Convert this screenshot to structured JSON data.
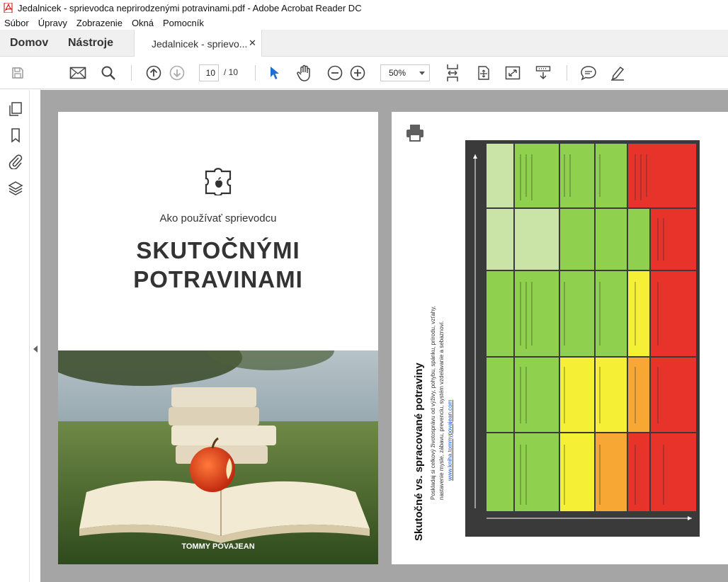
{
  "window": {
    "title": "Jedalnicek - sprievodca neprirodzenými potravinami.pdf - Adobe Acrobat Reader DC"
  },
  "menu": {
    "items": [
      "Súbor",
      "Úpravy",
      "Zobrazenie",
      "Okná",
      "Pomocník"
    ]
  },
  "tabs": {
    "home": "Domov",
    "tools": "Nástroje",
    "document": "Jedalnicek - sprievo...",
    "close_glyph": "✕"
  },
  "toolbar": {
    "current_page": "10",
    "total_pages": "/ 10",
    "zoom": "50%",
    "icons": [
      "save-icon",
      "email-icon",
      "search-icon",
      "prev-page-icon",
      "next-page-icon",
      "select-cursor-icon",
      "hand-tool-icon",
      "zoom-out-icon",
      "zoom-in-icon",
      "fit-page-icon",
      "scroll-mode-icon",
      "full-screen-icon",
      "page-layout-icon",
      "comment-icon",
      "highlight-icon"
    ]
  },
  "left_rail": {
    "icons": [
      "pages-icon",
      "bookmark-icon",
      "attachment-icon",
      "layers-icon"
    ]
  },
  "cover": {
    "subtitle": "Ako používať sprievodcu",
    "title_line1": "SKUTOČNÝMI",
    "title_line2": "POTRAVINAMI",
    "author": "TOMMY POVAJEAN"
  },
  "page2": {
    "title": "Skutočné vs. spracované potraviny",
    "desc_line1": "Poskladaj si celkový životosprávu od výživy, pohybu, spánku, prírodu, vzťahy,",
    "desc_line2": "nastavenie mysle, zábavu, prevenciu, systém vzdelávanie a sebaznoví.",
    "link": "www.kniha.tommypovajean.com",
    "colors": {
      "green": "#8fd14f",
      "light_green": "#c9e4a6",
      "yellow": "#f5ef35",
      "orange": "#f7a733",
      "red": "#e8332a",
      "frame": "#3a3a3a"
    }
  }
}
